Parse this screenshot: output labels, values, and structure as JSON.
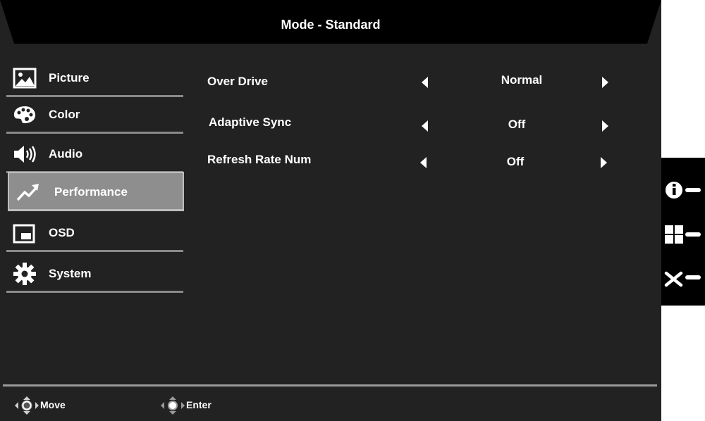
{
  "header": {
    "title": "Mode - Standard"
  },
  "menu": {
    "items": [
      {
        "label": "Picture",
        "icon": "picture-icon",
        "active": false
      },
      {
        "label": "Color",
        "icon": "palette-icon",
        "active": false
      },
      {
        "label": "Audio",
        "icon": "speaker-icon",
        "active": false
      },
      {
        "label": "Performance",
        "icon": "trending-up-icon",
        "active": true
      },
      {
        "label": "OSD",
        "icon": "osd-window-icon",
        "active": false
      },
      {
        "label": "System",
        "icon": "gear-icon",
        "active": false
      }
    ]
  },
  "options": [
    {
      "label": "Over Drive",
      "value": "Normal"
    },
    {
      "label": "Adaptive Sync",
      "value": "Off"
    },
    {
      "label": "Refresh Rate Num",
      "value": "Off"
    }
  ],
  "footer": {
    "move_label": "Move",
    "enter_label": "Enter"
  },
  "side_buttons": [
    {
      "icon": "info-icon"
    },
    {
      "icon": "grid-menu-icon"
    },
    {
      "icon": "close-icon"
    }
  ],
  "colors": {
    "background": "#222222",
    "active_item": "#8e8e8e",
    "divider": "#8a8a8a",
    "text": "#ffffff"
  }
}
